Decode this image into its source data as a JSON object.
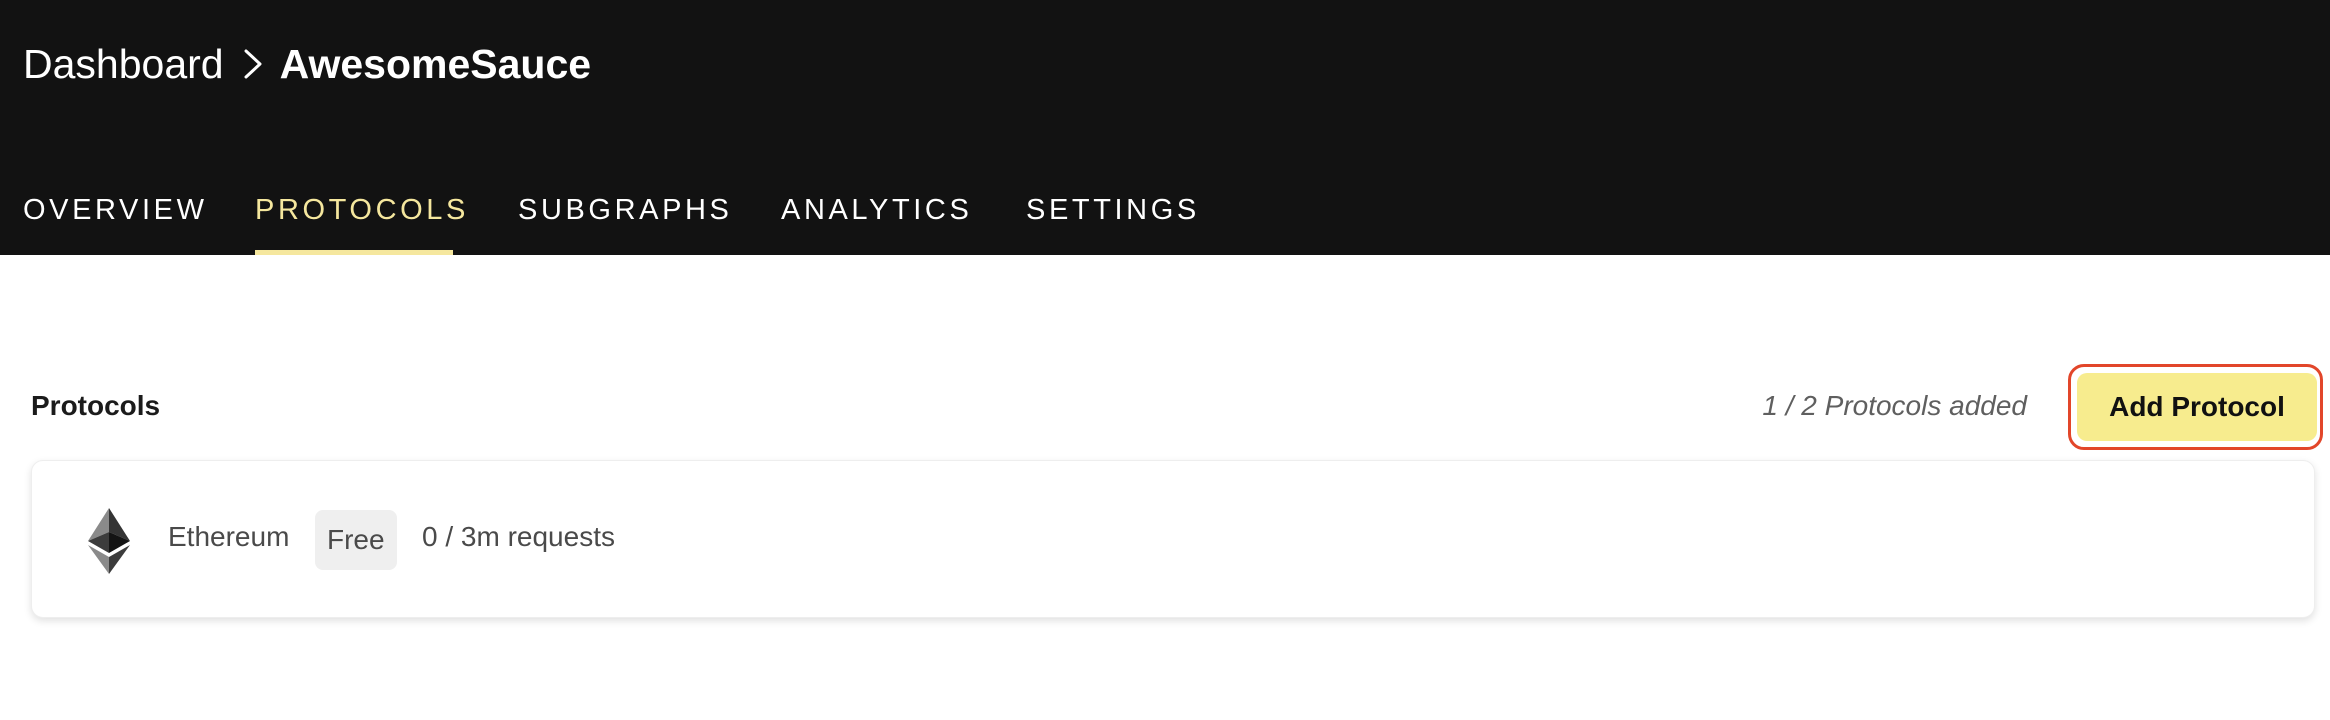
{
  "header": {
    "breadcrumb": {
      "root": "Dashboard",
      "separator_icon": "chevron-right-icon",
      "current": "AwesomeSauce"
    },
    "tabs": [
      {
        "label": "OVERVIEW",
        "active": false
      },
      {
        "label": "PROTOCOLS",
        "active": true
      },
      {
        "label": "SUBGRAPHS",
        "active": false
      },
      {
        "label": "ANALYTICS",
        "active": false
      },
      {
        "label": "SETTINGS",
        "active": false
      }
    ]
  },
  "protocols": {
    "title": "Protocols",
    "count_text": "1 / 2 Protocols added",
    "add_button_label": "Add Protocol",
    "items": [
      {
        "icon": "ethereum-icon",
        "name": "Ethereum",
        "plan": "Free",
        "usage": "0 / 3m requests"
      }
    ]
  },
  "colors": {
    "header_bg": "#121212",
    "accent_yellow": "#f5e79e",
    "button_bg": "#f7ec8e",
    "highlight_ring": "#e2462a",
    "badge_bg": "#efefef"
  }
}
